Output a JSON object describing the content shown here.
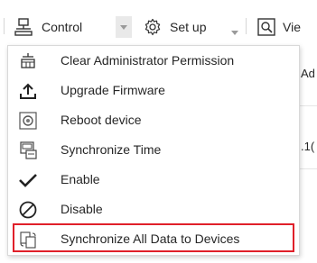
{
  "toolbar": {
    "control_label": "Control",
    "setup_label": "Set up",
    "view_label": "Vie"
  },
  "background": {
    "text_1": "Ad",
    "text_2": ".1("
  },
  "menu": {
    "items": [
      {
        "label": "Clear Administrator Permission",
        "icon": "clear-permission-icon"
      },
      {
        "label": "Upgrade Firmware",
        "icon": "upload-icon"
      },
      {
        "label": "Reboot device",
        "icon": "reboot-icon"
      },
      {
        "label": "Synchronize Time",
        "icon": "sync-time-icon"
      },
      {
        "label": "Enable",
        "icon": "checkmark-icon"
      },
      {
        "label": "Disable",
        "icon": "disable-icon"
      },
      {
        "label": "Synchronize All Data to Devices",
        "icon": "sync-data-icon"
      }
    ],
    "highlight_color": "#e0202a"
  }
}
